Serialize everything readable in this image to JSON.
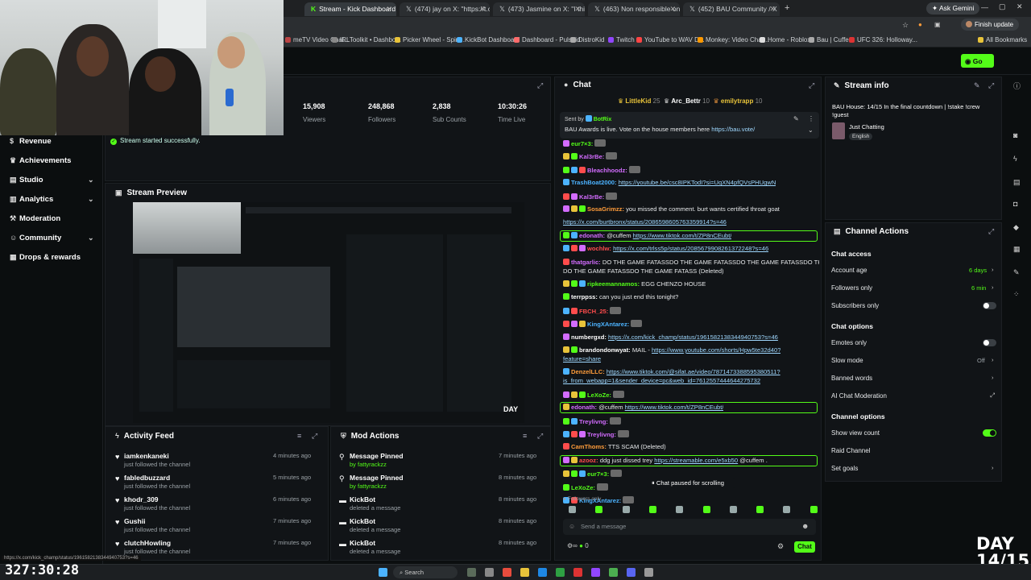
{
  "browser": {
    "tabs": [
      {
        "label": "Stream - Kick Dashboard",
        "active": true
      },
      {
        "label": "(474) jay on X: \"https://t.co/r..."
      },
      {
        "label": "(473) Jasmine on X: \"I think ab..."
      },
      {
        "label": "(463) Non responsible on X: \"T..."
      },
      {
        "label": "(452) BAU Community / X"
      }
    ],
    "ask_gemini": "Ask Gemini",
    "finish_update": "Finish update",
    "bookmarks": [
      "meTV Video Chat...",
      "IRLToolkit • Dashbo...",
      "Picker Wheel - Spin...",
      "KickBot Dashboard",
      "Dashboard - Pulsoid",
      "DistroKid",
      "Twitch",
      "YouTube to WAV D...",
      "Monkey: Video Chat...",
      "Home - Roblox",
      "Bau | Cuffem",
      "UFC 326: Holloway...",
      "All Bookmarks"
    ]
  },
  "header": {
    "go_live": "Go live"
  },
  "sidebar": {
    "items": [
      {
        "label": "Revenue",
        "icon": "dollar-icon"
      },
      {
        "label": "Achievements",
        "icon": "trophy-icon"
      },
      {
        "label": "Studio",
        "icon": "studio-icon",
        "chevron": true
      },
      {
        "label": "Analytics",
        "icon": "chart-icon",
        "chevron": true
      },
      {
        "label": "Moderation",
        "icon": "hammer-icon"
      },
      {
        "label": "Community",
        "icon": "people-icon",
        "chevron": true
      },
      {
        "label": "Drops & rewards",
        "icon": "gift-icon"
      }
    ]
  },
  "stats": [
    {
      "value": "15,908",
      "label": "Viewers"
    },
    {
      "value": "248,868",
      "label": "Followers"
    },
    {
      "value": "2,838",
      "label": "Sub Counts"
    },
    {
      "value": "10:30:26",
      "label": "Time Live"
    }
  ],
  "toast": "Stream started successfully.",
  "preview": {
    "title": "Stream Preview"
  },
  "activity_feed": {
    "title": "Activity Feed",
    "items": [
      {
        "name": "iamkenkaneki",
        "sub": "just followed the channel",
        "time": "4 minutes ago"
      },
      {
        "name": "fabledbuzzard",
        "sub": "just followed the channel",
        "time": "5 minutes ago"
      },
      {
        "name": "khodr_309",
        "sub": "just followed the channel",
        "time": "6 minutes ago"
      },
      {
        "name": "Gushii",
        "sub": "just followed the channel",
        "time": "7 minutes ago"
      },
      {
        "name": "clutchHowling",
        "sub": "just followed the channel",
        "time": "7 minutes ago"
      }
    ]
  },
  "mod_actions": {
    "title": "Mod Actions",
    "items": [
      {
        "name": "Message Pinned",
        "sub": "by fattyrackzz",
        "time": "7 minutes ago",
        "icon": "pin-icon"
      },
      {
        "name": "Message Pinned",
        "sub": "by fattyrackzz",
        "time": "8 minutes ago",
        "icon": "pin-icon"
      },
      {
        "name": "KickBot",
        "sub": "deleted a message",
        "time": "8 minutes ago",
        "icon": "trash-icon"
      },
      {
        "name": "KickBot",
        "sub": "deleted a message",
        "time": "8 minutes ago",
        "icon": "trash-icon"
      },
      {
        "name": "KickBot",
        "sub": "deleted a message",
        "time": "8 minutes ago",
        "icon": "trash-icon"
      }
    ]
  },
  "chat": {
    "title": "Chat",
    "top_gifters": [
      {
        "name": "LittleKid",
        "count": "25"
      },
      {
        "name": "Arc_Bettr",
        "count": "10"
      },
      {
        "name": "emilytrapp",
        "count": "10"
      }
    ],
    "pinned": {
      "sent_by": "Sent by",
      "sender": "BotRix",
      "text": "BAU Awards is live. Vote on the house members here ",
      "link": "https://bau.vote/"
    },
    "messages": [
      {
        "user": "eur7×3:",
        "color": "#53fc18",
        "text": "",
        "link": ""
      },
      {
        "user": "Kal3rBe:",
        "color": "#d36cff",
        "text": "",
        "link": ""
      },
      {
        "user": "Bleachhoodz:",
        "color": "#d36cff",
        "text": "",
        "link": ""
      },
      {
        "user": "TrashBoat2000:",
        "color": "#4cb3ff",
        "text": "",
        "link": "https://youtube.be/csc8IPKTodI?si=UqXN4pfQVsPHUgwN"
      },
      {
        "user": "Kal3rBe:",
        "color": "#d36cff",
        "text": "",
        "link": ""
      },
      {
        "user": "SosaGrimzz:",
        "color": "#ff9c3a",
        "text": "you missed the comment. burt wants certified throat goat",
        "link": ""
      },
      {
        "user": "",
        "color": "#fff",
        "text": "",
        "link": "https://x.com/burtbronx/status/2086598605763359914?s=46"
      },
      {
        "user": "edonath:",
        "color": "#d36cff",
        "text": "@cuffem ",
        "link": "https://www.tiktok.com/t/ZP8nCEubt/",
        "highlight": true
      },
      {
        "user": "wochlw:",
        "color": "#ff4c4c",
        "text": "",
        "link": "https://x.com/trlss5p/status/2085679908261372248?s=46"
      },
      {
        "user": "thatgarlic:",
        "color": "#d36cff",
        "text": "DO THE GAME FATASSDO THE GAME FATASSDO THE GAME FATASSDO THE GAME FATASS",
        "link": ""
      },
      {
        "user": "",
        "color": "#fff",
        "text": "DO THE GAME FATASSDO THE GAME FATASS (Deleted)",
        "link": ""
      },
      {
        "user": "ripkeemannamos:",
        "color": "#53fc18",
        "text": "EGG CHENZO HOUSE",
        "link": ""
      },
      {
        "user": "terrppss:",
        "color": "#fff",
        "text": "can you just end this tonight?",
        "link": ""
      },
      {
        "user": "FBCH_25:",
        "color": "#ff4c4c",
        "text": "",
        "link": ""
      },
      {
        "user": "KingXAntarez:",
        "color": "#4cb3ff",
        "text": "",
        "link": ""
      },
      {
        "user": "numbergxd:",
        "color": "#fff",
        "text": "",
        "link": "https://x.com/kick_champ/status/1961582138344940753?s=46"
      },
      {
        "user": "brandondonwyat:",
        "color": "#fff",
        "text": "MAIL - ",
        "link": "https://www.youtube.com/shorts/Hpw5te32d40?"
      },
      {
        "user": "",
        "color": "#fff",
        "text": "",
        "link": "feature=share"
      },
      {
        "user": "DenzelLLC:",
        "color": "#ff9c3a",
        "text": "",
        "link": "https://www.tiktok.com/@sifat.ae/video/7871473388595380511?"
      },
      {
        "user": "",
        "color": "#fff",
        "text": "",
        "link": "is_from_webapp=1&sender_device=pc&web_id=7612557444644275732"
      },
      {
        "user": "LeXoZe:",
        "color": "#53fc18",
        "text": "",
        "link": ""
      },
      {
        "user": "edonath:",
        "color": "#d36cff",
        "text": "@cuffem ",
        "link": "https://www.tiktok.com/t/ZP8nCEubt/",
        "highlight": true
      },
      {
        "user": "Treylivng:",
        "color": "#d36cff",
        "text": "",
        "link": ""
      },
      {
        "user": "Treylivng:",
        "color": "#d36cff",
        "text": "",
        "link": ""
      },
      {
        "user": "CamThoms:",
        "color": "#ff9c3a",
        "text": "TTS SCAM (Deleted)",
        "link": ""
      },
      {
        "user": "azooz:",
        "color": "#ff4c4c",
        "text": "ddg just dissed trey ",
        "link": "https://streamable.com/e5xb50",
        "tail": " @cuffem .",
        "highlight": true
      },
      {
        "user": "eur7×3:",
        "color": "#53fc18",
        "text": "",
        "link": ""
      },
      {
        "user": "LeXoZe:",
        "color": "#53fc18",
        "text": "",
        "link": ""
      },
      {
        "user": "KingXAntarez:",
        "color": "#4cb3ff",
        "text": "",
        "link": ""
      }
    ],
    "paused": "Chat paused for scrolling",
    "followers_only": "Followers only",
    "input_placeholder": "Send a message",
    "points": "0",
    "send_label": "Chat"
  },
  "stream_info": {
    "title": "Stream info",
    "stream_title": "BAU House: 14/15 In the final countdown | !stake !crew !guest",
    "category": "Just Chatting",
    "language": "English"
  },
  "channel_actions": {
    "title": "Channel Actions",
    "chat_access": "Chat access",
    "account_age": {
      "label": "Account age",
      "value": "6 days"
    },
    "followers_only": {
      "label": "Followers only",
      "value": "6 min"
    },
    "subscribers_only": {
      "label": "Subscribers only",
      "on": false
    },
    "chat_options": "Chat options",
    "emotes_only": {
      "label": "Emotes only",
      "on": false
    },
    "slow_mode": {
      "label": "Slow mode",
      "value": "Off"
    },
    "banned_words": "Banned words",
    "ai_moderation": "AI Chat Moderation",
    "channel_options": "Channel options",
    "show_view_count": {
      "label": "Show view count",
      "on": true
    },
    "raid_channel": "Raid Channel",
    "set_goals": "Set goals"
  },
  "overlay": {
    "day_line1": "DAY",
    "day_line2": "14/15",
    "timer": "327:30:28",
    "status_url": "https://x.com/kick_champ/status/1961582138344940753?s=46"
  },
  "taskbar": {
    "search": "Search"
  },
  "colors": {
    "accent": "#53fc18",
    "link": "#9fd8ff",
    "bg": "#0b0e0f",
    "panel": "#111417"
  }
}
